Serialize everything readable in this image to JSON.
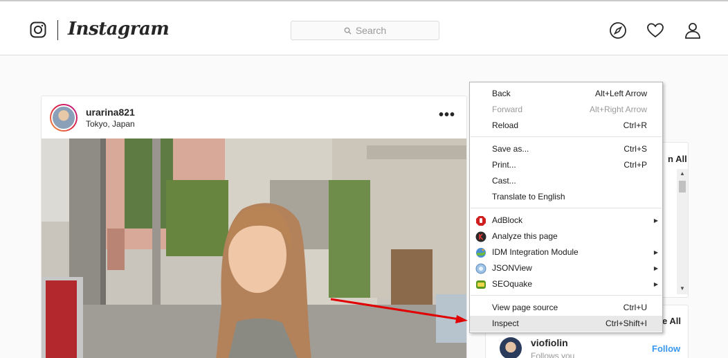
{
  "header": {
    "wordmark": "Instagram",
    "search_placeholder": "Search"
  },
  "post": {
    "username": "urarina821",
    "location": "Tokyo, Japan",
    "more_glyph": "•••"
  },
  "sidebar": {
    "stories_see_all": "n All",
    "suggestions_see_all": "e All",
    "suggestion": {
      "username": "viofiolin",
      "subtitle": "Follows you",
      "follow_label": "Follow"
    }
  },
  "context_menu": {
    "items": [
      {
        "label": "Back",
        "shortcut": "Alt+Left Arrow"
      },
      {
        "label": "Forward",
        "shortcut": "Alt+Right Arrow"
      },
      {
        "label": "Reload",
        "shortcut": "Ctrl+R"
      },
      {
        "label": "Save as...",
        "shortcut": "Ctrl+S"
      },
      {
        "label": "Print...",
        "shortcut": "Ctrl+P"
      },
      {
        "label": "Cast..."
      },
      {
        "label": "Translate to English"
      },
      {
        "label": "AdBlock"
      },
      {
        "label": "Analyze this page"
      },
      {
        "label": "IDM Integration Module"
      },
      {
        "label": "JSONView"
      },
      {
        "label": "SEOquake"
      },
      {
        "label": "View page source",
        "shortcut": "Ctrl+U"
      },
      {
        "label": "Inspect",
        "shortcut": "Ctrl+Shift+I"
      }
    ]
  },
  "icons": {
    "logo": "instagram-camera-icon",
    "search": "magnifier-icon",
    "explore": "compass-icon",
    "activity": "heart-icon",
    "profile": "person-icon",
    "adblock": "stop-hand-icon",
    "analyze": "k-circle-icon",
    "idm": "idm-globe-icon",
    "jsonview": "json-globe-icon",
    "seoquake": "seo-badge-icon",
    "submenu": "triangle-right-icon"
  },
  "colors": {
    "accent_link": "#3897f0",
    "annotation_arrow": "#e00000",
    "adblock": "#d01f1f",
    "seoquake": "#5a9a1e"
  }
}
